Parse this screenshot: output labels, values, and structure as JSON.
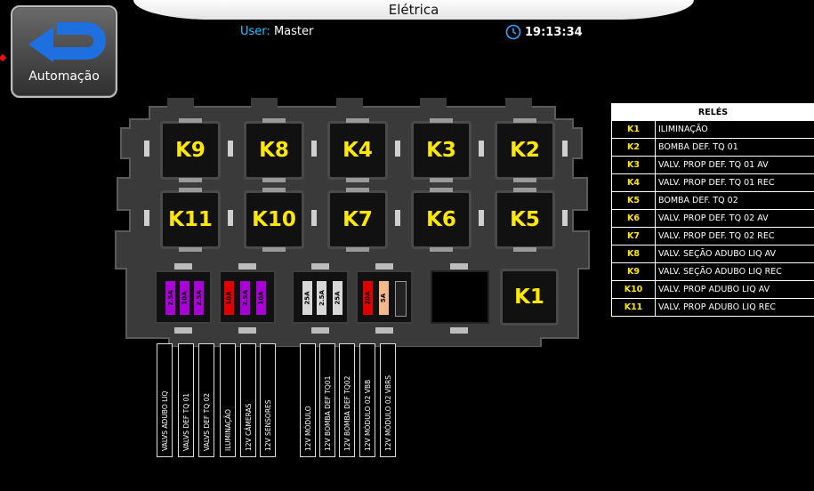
{
  "header": {
    "title": "Elétrica",
    "user_label": "User:",
    "user_name": "Master",
    "time": "19:13:34"
  },
  "back_button": {
    "label": "Automação"
  },
  "relays": [
    {
      "id": "K9"
    },
    {
      "id": "K8"
    },
    {
      "id": "K4"
    },
    {
      "id": "K3"
    },
    {
      "id": "K2"
    },
    {
      "id": "K11"
    },
    {
      "id": "K10"
    },
    {
      "id": "K7"
    },
    {
      "id": "K6"
    },
    {
      "id": "K5"
    },
    {
      "id": "K1"
    }
  ],
  "fuses": {
    "group1": [
      "2.5A",
      "10A",
      "2.5A",
      "10A",
      "2.5A",
      "10A"
    ],
    "group1_colors": [
      "#a800d6",
      "#a800d6",
      "#a800d6",
      "#e00000",
      "#a800d6",
      "#a800d6"
    ],
    "group2": [
      "25A",
      "2.5A",
      "25A"
    ],
    "group3": [
      "20A",
      "5A"
    ]
  },
  "fuse_labels": [
    "VALVS ADUBO LIQ",
    "VALVS DEF TQ 01",
    "VALVS DEF TQ 02",
    "ILUMINAÇÃO",
    "12V CÂMERAS",
    "12V SENSORES",
    "12V MÓDULO",
    "12V BOMBA DEF TQ01",
    "12V BOMBA DEF TQ02",
    "12V MÓDULO 02 VBB",
    "12V MÓDULO 02 VBRS"
  ],
  "relay_table": {
    "title": "RELÉS",
    "rows": [
      {
        "k": "K1",
        "desc": "ILIMINAÇÃO"
      },
      {
        "k": "K2",
        "desc": "BOMBA DEF. TQ 01"
      },
      {
        "k": "K3",
        "desc": "VALV. PROP DEF. TQ 01 AV"
      },
      {
        "k": "K4",
        "desc": "VALV. PROP DEF. TQ 01  REC"
      },
      {
        "k": "K5",
        "desc": "BOMBA DEF. TQ 02"
      },
      {
        "k": "K6",
        "desc": "VALV. PROP DEF. TQ 02 AV"
      },
      {
        "k": "K7",
        "desc": "VALV. PROP DEF. TQ 02  REC"
      },
      {
        "k": "K8",
        "desc": "VALV. SEÇÃO ADUBO LIQ AV"
      },
      {
        "k": "K9",
        "desc": "VALV. SEÇÃO ADUBO LIQ REC"
      },
      {
        "k": "K10",
        "desc": "VALV. PROP ADUBO LIQ AV"
      },
      {
        "k": "K11",
        "desc": "VALV. PROP ADUBO LIQ REC"
      }
    ]
  }
}
